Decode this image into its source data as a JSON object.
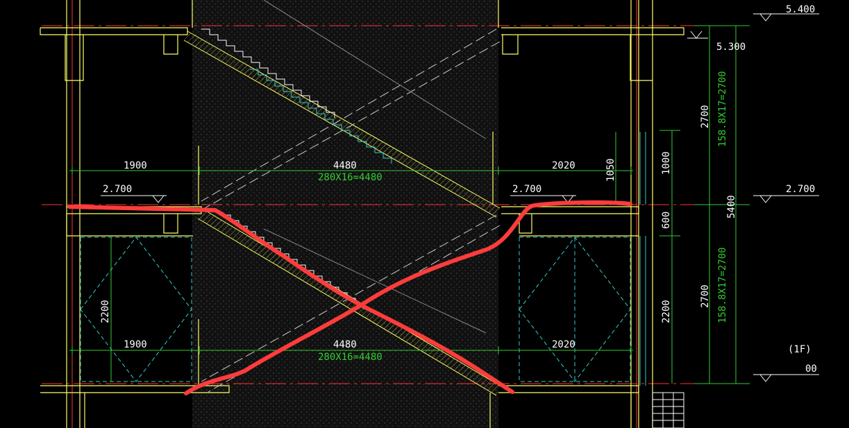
{
  "colors": {
    "background": "#000000",
    "structure": "#ffff66",
    "dimension": "#33cc33",
    "hatch_region": "#3a3a3a",
    "window": "#33cccc",
    "axis": "#ff3333",
    "annotation": "#ff3c3c",
    "text_white": "#ffffff"
  },
  "levels": {
    "roof": "5.400",
    "top_landing": "5.300",
    "mid_left": "2.700",
    "mid_right": "2.700",
    "mid_side": "2.700",
    "ground": "00",
    "floor_tag": "(1F)"
  },
  "dims": {
    "left_width_upper": "1900",
    "stair_run_upper": "4480",
    "stair_run_formula_upper": "280X16=4480",
    "right_width_upper": "2020",
    "left_width_lower": "1900",
    "stair_run_lower": "4480",
    "stair_run_formula_lower": "280X16=4480",
    "right_width_lower": "2020",
    "rail_height": "1050",
    "window_height_upper": "1000",
    "sill_600": "600",
    "window_height_lower_right": "2200",
    "window_height_lower_left": "2200",
    "flight_upper": "2700",
    "flight_upper_formula": "158.8X17=2700",
    "flight_lower": "2700",
    "flight_lower_formula": "158.8X17=2700",
    "total_height": "5400"
  }
}
